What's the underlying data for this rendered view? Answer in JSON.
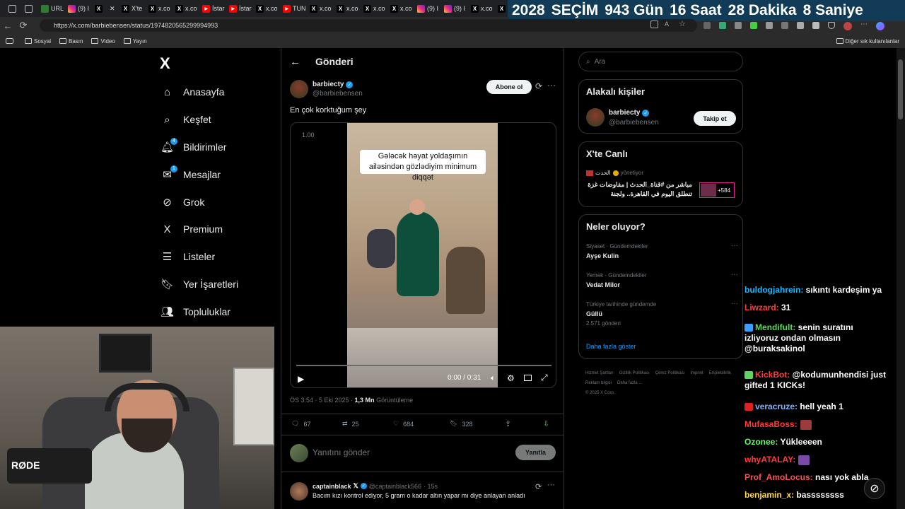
{
  "browser": {
    "tabs": [
      {
        "label": "URL",
        "icon": "green-square-icon",
        "color": "#2e7d32"
      },
      {
        "label": "(9) I",
        "icon": "instagram-icon",
        "color": "#c13584"
      },
      {
        "label": "",
        "icon": "x-icon",
        "color": "#000000"
      },
      {
        "label": "X'te",
        "icon": "x-icon",
        "color": "#000000"
      },
      {
        "label": "x.co",
        "icon": "x-icon",
        "color": "#000000"
      },
      {
        "label": "x.co",
        "icon": "x-icon",
        "color": "#000000"
      },
      {
        "label": "İstar",
        "icon": "youtube-icon",
        "color": "#ff0000"
      },
      {
        "label": "İstar",
        "icon": "youtube-icon",
        "color": "#ff0000"
      },
      {
        "label": "x.co",
        "icon": "x-icon",
        "color": "#000000"
      },
      {
        "label": "TUN",
        "icon": "youtube-icon",
        "color": "#ff0000"
      },
      {
        "label": "x.co",
        "icon": "x-icon",
        "color": "#000000"
      },
      {
        "label": "x.co",
        "icon": "x-icon",
        "color": "#000000"
      },
      {
        "label": "x.co",
        "icon": "x-icon",
        "color": "#000000"
      },
      {
        "label": "x.co",
        "icon": "x-icon",
        "color": "#000000"
      },
      {
        "label": "(9) I",
        "icon": "instagram-icon",
        "color": "#c13584"
      },
      {
        "label": "(9) I",
        "icon": "instagram-icon",
        "color": "#c13584"
      },
      {
        "label": "x.co",
        "icon": "x-icon",
        "color": "#000000"
      },
      {
        "label": "x.co",
        "icon": "x-icon",
        "color": "#000000"
      }
    ],
    "url": "https://x.com/barbiebensen/status/1974820565299994993",
    "bookmarks": [
      "Sosyal",
      "Basın",
      "Video",
      "Yayın"
    ],
    "other_bookmarks": "Diğer sık kullanılanlar"
  },
  "countdown": {
    "year": "2028",
    "label": "SEÇİM",
    "days": "943 Gün",
    "hours": "16 Saat",
    "minutes": "28 Dakika",
    "seconds": "8 Saniye",
    "bg": "#123b57"
  },
  "sidebar": {
    "logo": "X",
    "items": [
      {
        "label": "Anasayfa",
        "icon": "home-icon",
        "badge": ""
      },
      {
        "label": "Keşfet",
        "icon": "search-icon",
        "badge": ""
      },
      {
        "label": "Bildirimler",
        "icon": "bell-icon",
        "badge": "4"
      },
      {
        "label": "Mesajlar",
        "icon": "mail-icon",
        "badge": "1"
      },
      {
        "label": "Grok",
        "icon": "grok-icon",
        "badge": ""
      },
      {
        "label": "Premium",
        "icon": "x-icon",
        "badge": ""
      },
      {
        "label": "Listeler",
        "icon": "list-icon",
        "badge": ""
      },
      {
        "label": "Yer İşaretleri",
        "icon": "bookmark-icon",
        "badge": ""
      },
      {
        "label": "Topluluklar",
        "icon": "people-icon",
        "badge": ""
      }
    ]
  },
  "post": {
    "header": "Gönderi",
    "author_name": "barbiecty",
    "author_handle": "@barbiebensen",
    "subscribe_label": "Abone ol",
    "text": "En çok korktuğum şey",
    "video": {
      "speed_label": "1.00",
      "caption": "Gələcək həyat yoldaşımın ailəsindən gözlədiyim minimum diqqət",
      "time": "0:00 / 0:31"
    },
    "meta_time": "ÖS 3:54 · 5 Eki 2025 · ",
    "views": "1,3 Mn",
    "views_label": " Görüntüleme",
    "stats": {
      "replies": "67",
      "reposts": "25",
      "likes": "684",
      "bookmarks": "328"
    },
    "reply_placeholder": "Yanıtını gönder",
    "reply_button": "Yanıtla"
  },
  "reply": {
    "author_name": "captainblack",
    "author_handle": "@captainblack566",
    "time": "· 15s",
    "text": "Bacım kızı kontrol ediyor, 5 gram o kadar altın yapar mı diye anlayan anladı"
  },
  "right": {
    "search_placeholder": "Ara",
    "related_title": "Alakalı kişiler",
    "related_name": "barbiecty",
    "related_handle": "@barbiebensen",
    "follow_label": "Takip et",
    "live_title": "X'te Canlı",
    "live_host": "الحدث",
    "live_host_suffix": "yönetiyor",
    "live_text": "مباشر من #قناة_الحدث | مفاوضات غزة تنطلق اليوم في القاهرة.. ولجنة",
    "live_count": "+584",
    "trends_title": "Neler oluyor?",
    "trends": [
      {
        "category": "Siyaset · Gündemdekiler",
        "name": "Ayşe Kulin",
        "count": ""
      },
      {
        "category": "Yemek · Gündemdekiler",
        "name": "Vedat Milor",
        "count": ""
      },
      {
        "category": "Türkiye tarihinde gündemde",
        "name": "Güllü",
        "count": "2.571 gönderi"
      }
    ],
    "show_more": "Daha fazla göster",
    "footer_links": [
      "Hizmet Şartları",
      "Gizlilik Politikası",
      "Çerez Politikası",
      "Imprint",
      "Erişilebilirlik",
      "Reklam bilgisi",
      "Daha fazla ..."
    ],
    "copyright": "© 2025 X Corp."
  },
  "chat": [
    {
      "user": "buldogjahrein:",
      "color": "#19b7ff",
      "text": " sıkıntı kardeşim ya"
    },
    {
      "user": "Liwzard:",
      "color": "#ff3b3b",
      "text": " 31"
    },
    {
      "user": "Mendifult:",
      "color": "#5cd65c",
      "text": " senin suratını izliyoruz ondan olmasın @buraksakinol"
    },
    {
      "user": "KickBot:",
      "color": "#ff3b3b",
      "text": " @kodumunhendisi just gifted 1 KICKs!"
    },
    {
      "user": "veracruze:",
      "color": "#7fb3ff",
      "text": " hell yeah 1"
    },
    {
      "user": "MufasaBoss:",
      "color": "#ff3b3b",
      "text": ""
    },
    {
      "user": "Ozonee:",
      "color": "#5cff5c",
      "text": " Yükleeeen"
    },
    {
      "user": "whyATALAY:",
      "color": "#ff3b3b",
      "text": ""
    },
    {
      "user": "Prof_AmoLocus:",
      "color": "#ff5050",
      "text": " nası yok abla"
    },
    {
      "user": "benjamin_x:",
      "color": "#ffd94d",
      "text": " bassssssss"
    }
  ],
  "webcam": {
    "mic_brand": "RØDE"
  }
}
